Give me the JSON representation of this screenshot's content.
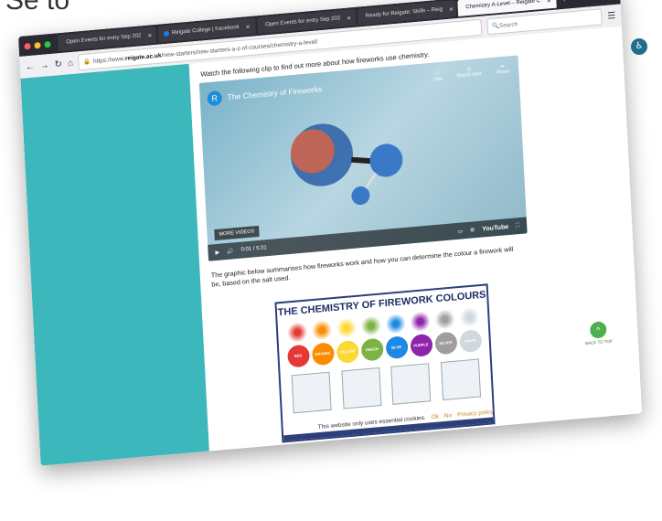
{
  "partial_text": "Se to",
  "browser": {
    "tabs": [
      {
        "label": "Open Events for entry Sep 202",
        "active": false
      },
      {
        "label": "Reigate College | Facebook",
        "active": false
      },
      {
        "label": "Open Events for entry Sep 202",
        "active": false
      },
      {
        "label": "Ready for Reigate: Skills – Reig",
        "active": false
      },
      {
        "label": "Chemistry A-Level – Reigate C",
        "active": true
      }
    ],
    "url_prefix": "https://www.",
    "url_domain": "reigate.ac.uk",
    "url_path": "/new-starters/new-starters-a-z-of-courses/chemistry-a-level/",
    "search_placeholder": "Search"
  },
  "page": {
    "intro": "Watch the following clip to find out more about how fireworks use chemistry.",
    "video": {
      "title": "The Chemistry of Fireworks",
      "info_label": "Info",
      "watch_later_label": "Watch later",
      "share_label": "Share",
      "more_videos": "MORE VIDEOS",
      "time": "0:01 / 5:31",
      "youtube": "YouTube"
    },
    "graphic_text": "The graphic below summarises how fireworks work and how you can determine the colour a firework will be, based on the salt used.",
    "infographic": {
      "title": "THE CHEMISTRY OF FIREWORK COLOURS",
      "colors": [
        {
          "name": "RED",
          "hex": "#e53935"
        },
        {
          "name": "ORANGE",
          "hex": "#fb8c00"
        },
        {
          "name": "YELLOW",
          "hex": "#fdd835"
        },
        {
          "name": "GREEN",
          "hex": "#7cb342"
        },
        {
          "name": "BLUE",
          "hex": "#1e88e5"
        },
        {
          "name": "PURPLE",
          "hex": "#8e24aa"
        },
        {
          "name": "SILVER",
          "hex": "#9e9e9e"
        },
        {
          "name": "WHITE",
          "hex": "#cfd8dc"
        }
      ]
    },
    "back_to_top": "BACK TO TOP",
    "cookies": {
      "text": "This website only uses essential cookies.",
      "ok": "Ok",
      "no": "No",
      "privacy": "Privacy policy"
    }
  }
}
